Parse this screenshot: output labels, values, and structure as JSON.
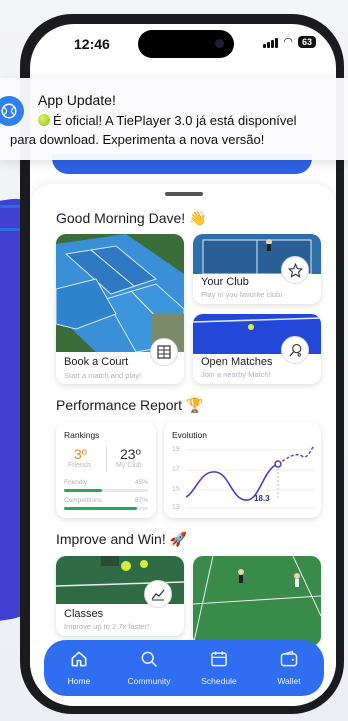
{
  "status": {
    "time": "12:46",
    "battery": "63"
  },
  "notification": {
    "title": "App Update!",
    "body_line1": "É oficial! A TiePlayer 3.0 já está disponível",
    "body_line2": "para download. Experimenta a nova versão!"
  },
  "greeting": "Good Morning Dave! 👋",
  "cards": {
    "book": {
      "title": "Book a Court",
      "subtitle": "Start a match and play!"
    },
    "club": {
      "title": "Your Club",
      "subtitle": "Play in you favorite club!"
    },
    "matches": {
      "title": "Open Matches",
      "subtitle": "Join a nearby Match!"
    }
  },
  "performance": {
    "title": "Performance Report 🏆",
    "rankings": {
      "title": "Rankings",
      "friends_rank": "3º",
      "friends_label": "Friends",
      "club_rank": "23º",
      "club_label": "My Club",
      "friendly_label": "Friendly",
      "friendly_value": "45%",
      "friendly_pct": 45,
      "competitions_label": "Competitions",
      "competitions_value": "87%",
      "competitions_pct": 87
    },
    "evolution": {
      "title": "Evolution",
      "y_ticks": [
        "19",
        "17",
        "15",
        "13"
      ],
      "highlight": "18.3"
    }
  },
  "improve": {
    "title": "Improve and Win! 🚀",
    "classes": {
      "title": "Classes",
      "subtitle": "Improve up to 2.7x faster!"
    }
  },
  "tabs": [
    {
      "label": "Home",
      "icon": "home-icon"
    },
    {
      "label": "Community",
      "icon": "search-icon"
    },
    {
      "label": "Schedule",
      "icon": "calendar-icon"
    },
    {
      "label": "Wallet",
      "icon": "wallet-icon"
    }
  ],
  "colors": {
    "accent": "#2f6ef0",
    "progress": "#2aa55a",
    "chart_line": "#4b3fc7"
  }
}
